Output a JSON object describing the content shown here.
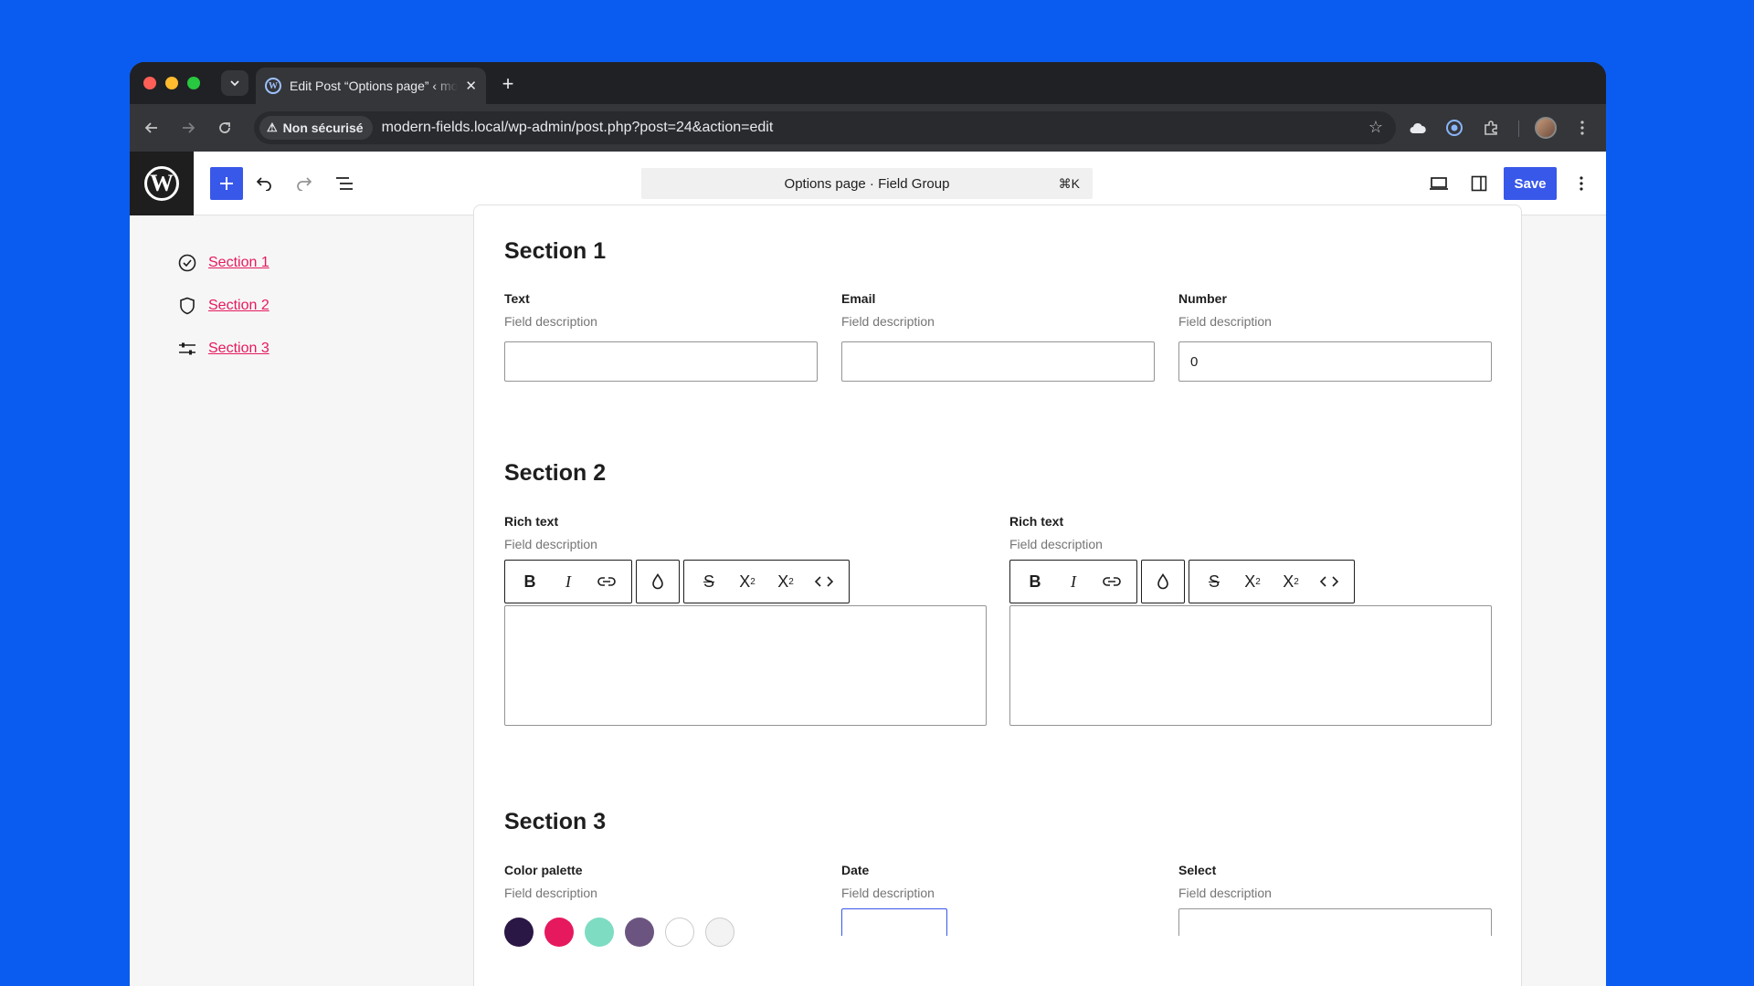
{
  "browser": {
    "tab_title": "Edit Post “Options page” ‹ modern-fields",
    "security_label": "Non sécurisé",
    "url": "modern-fields.local/wp-admin/post.php?post=24&action=edit"
  },
  "editor": {
    "command_bar_label": "Options page · Field Group",
    "command_shortcut": "⌘K",
    "save_label": "Save"
  },
  "sidebar": {
    "items": [
      {
        "label": "Section 1",
        "icon": "check-circle-icon"
      },
      {
        "label": "Section 2",
        "icon": "shield-icon"
      },
      {
        "label": "Section 3",
        "icon": "sliders-icon"
      }
    ]
  },
  "sections": [
    {
      "title": "Section 1",
      "fields": [
        {
          "label": "Text",
          "description": "Field description",
          "value": ""
        },
        {
          "label": "Email",
          "description": "Field description",
          "value": ""
        },
        {
          "label": "Number",
          "description": "Field description",
          "value": "0"
        }
      ]
    },
    {
      "title": "Section 2",
      "fields": [
        {
          "label": "Rich text",
          "description": "Field description"
        },
        {
          "label": "Rich text",
          "description": "Field description"
        }
      ]
    },
    {
      "title": "Section 3",
      "fields": [
        {
          "label": "Color palette",
          "description": "Field description"
        },
        {
          "label": "Date",
          "description": "Field description"
        },
        {
          "label": "Select",
          "description": "Field description"
        }
      ]
    }
  ],
  "richtext_toolbar": {
    "bold": "B",
    "italic": "I",
    "superscript": "X",
    "subscript": "X"
  },
  "colors": {
    "accent": "#3858e9",
    "link": "#e6195e",
    "palette": [
      "#2a1745",
      "#e6195e",
      "#7ddcc2",
      "#6b5580",
      "#ffffff",
      "#f3f3f3"
    ]
  }
}
